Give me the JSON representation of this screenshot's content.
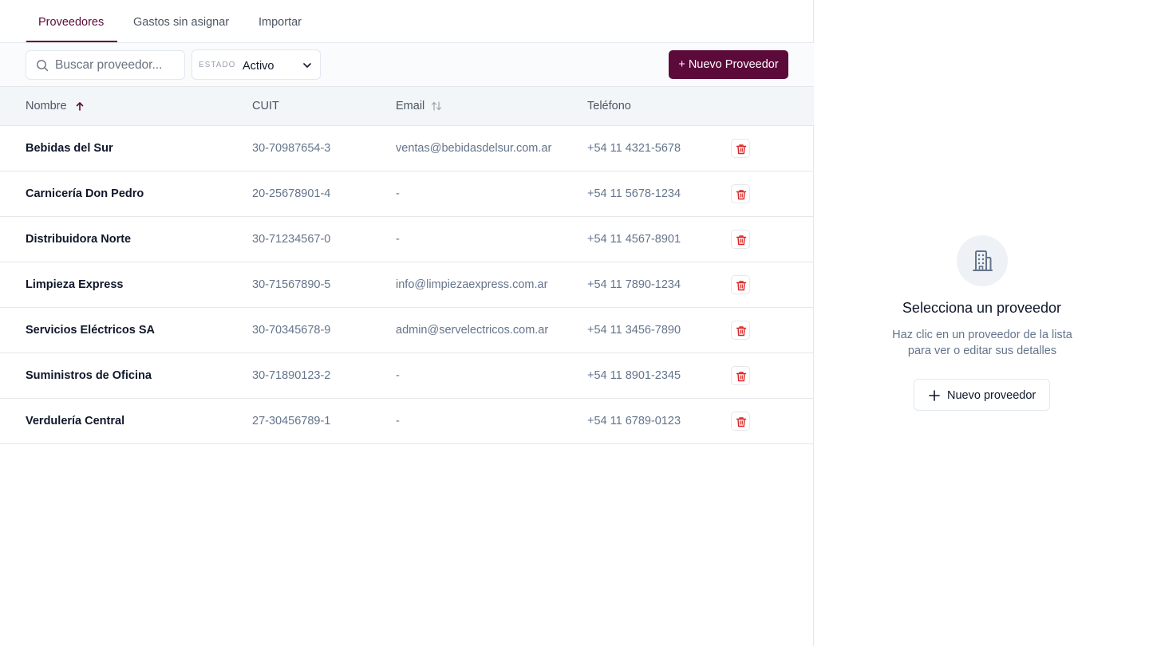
{
  "tabs": [
    {
      "label": "Proveedores",
      "active": true
    },
    {
      "label": "Gastos sin asignar",
      "active": false
    },
    {
      "label": "Importar",
      "active": false
    }
  ],
  "toolbar": {
    "search_placeholder": "Buscar proveedor...",
    "search_icon": "search-icon",
    "status_label": "ESTADO",
    "status_value": "Activo",
    "new_button_label": "+ Nuevo Proveedor"
  },
  "table": {
    "columns": [
      {
        "label": "Nombre",
        "sort": "asc"
      },
      {
        "label": "CUIT",
        "sort": "none"
      },
      {
        "label": "Email",
        "sort": "sortable"
      },
      {
        "label": "Teléfono",
        "sort": "none"
      }
    ],
    "rows": [
      {
        "name": "Bebidas del Sur",
        "cuit": "30-70987654-3",
        "email": "ventas@bebidasdelsur.com.ar",
        "phone": "+54 11 4321-5678"
      },
      {
        "name": "Carnicería Don Pedro",
        "cuit": "20-25678901-4",
        "email": "-",
        "phone": "+54 11 5678-1234"
      },
      {
        "name": "Distribuidora Norte",
        "cuit": "30-71234567-0",
        "email": "-",
        "phone": "+54 11 4567-8901"
      },
      {
        "name": "Limpieza Express",
        "cuit": "30-71567890-5",
        "email": "info@limpiezaexpress.com.ar",
        "phone": "+54 11 7890-1234"
      },
      {
        "name": "Servicios Eléctricos SA",
        "cuit": "30-70345678-9",
        "email": "admin@servelectricos.com.ar",
        "phone": "+54 11 3456-7890"
      },
      {
        "name": "Suministros de Oficina",
        "cuit": "30-71890123-2",
        "email": "-",
        "phone": "+54 11 8901-2345"
      },
      {
        "name": "Verdulería Central",
        "cuit": "27-30456789-1",
        "email": "-",
        "phone": "+54 11 6789-0123"
      }
    ]
  },
  "detail_panel": {
    "icon": "building-icon",
    "title": "Selecciona un proveedor",
    "description_line1": "Haz clic en un proveedor de la lista",
    "description_line2": "para ver o editar sus detalles",
    "new_button_label": "Nuevo proveedor"
  },
  "colors": {
    "primary": "#5b0a3a",
    "danger": "#dc2626",
    "muted_text": "#64748b",
    "header_bg": "#f3f6f9"
  }
}
